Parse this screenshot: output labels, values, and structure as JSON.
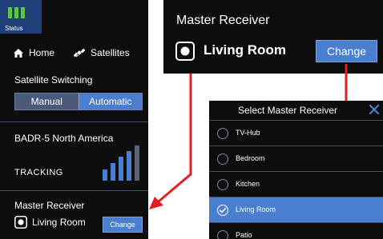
{
  "status": {
    "label": "Status",
    "color": "#5fc644"
  },
  "nav": {
    "home": "Home",
    "satellites": "Satellites"
  },
  "satellite_switching": {
    "title": "Satellite Switching",
    "options": [
      "Manual",
      "Automatic"
    ],
    "selected": "Automatic"
  },
  "satellite": {
    "name": "BADR-5 North America",
    "state": "TRACKING",
    "signal_strength_bars": 5,
    "signal_active_bars": 4
  },
  "master_receiver": {
    "title": "Master Receiver",
    "room": "Living Room",
    "change_label": "Change"
  },
  "select_dialog": {
    "title": "Select Master Receiver",
    "close": "✕",
    "items": [
      {
        "label": "TV-Hub",
        "selected": false
      },
      {
        "label": "Bedroom",
        "selected": false
      },
      {
        "label": "Kitchen",
        "selected": false
      },
      {
        "label": "Living Room",
        "selected": true
      },
      {
        "label": "Patio",
        "selected": false
      }
    ]
  },
  "colors": {
    "accent": "#4a7fd0",
    "panel": "#0d0d0d",
    "annotation": "#e02020"
  }
}
